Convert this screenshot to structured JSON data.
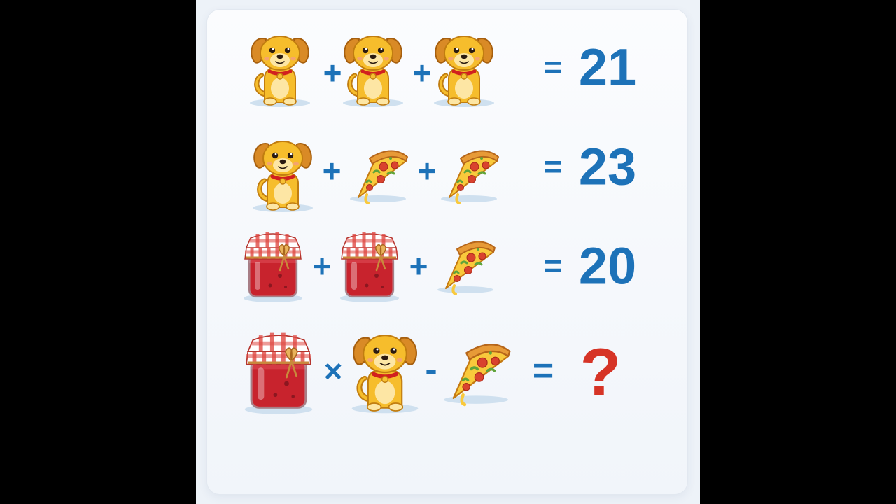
{
  "puzzle": {
    "rows": [
      {
        "items": [
          "dog-icon",
          "dog-icon",
          "dog-icon"
        ],
        "operators": [
          "+",
          "+"
        ],
        "equals": "=",
        "result": "21"
      },
      {
        "items": [
          "dog-icon",
          "pizza-slice-icon",
          "pizza-slice-icon"
        ],
        "operators": [
          "+",
          "+"
        ],
        "equals": "=",
        "result": "23"
      },
      {
        "items": [
          "jam-jar-icon",
          "jam-jar-icon",
          "pizza-slice-icon"
        ],
        "operators": [
          "+",
          "+"
        ],
        "equals": "=",
        "result": "20"
      },
      {
        "items": [
          "jam-jar-icon",
          "dog-icon",
          "pizza-slice-icon"
        ],
        "operators": [
          "×",
          "-"
        ],
        "equals": "=",
        "result": "?"
      }
    ]
  },
  "colors": {
    "operator": "#1d72b8",
    "result": "#1d72b8",
    "question": "#d63426",
    "background": "#000000",
    "card": "#f7f9fc"
  }
}
